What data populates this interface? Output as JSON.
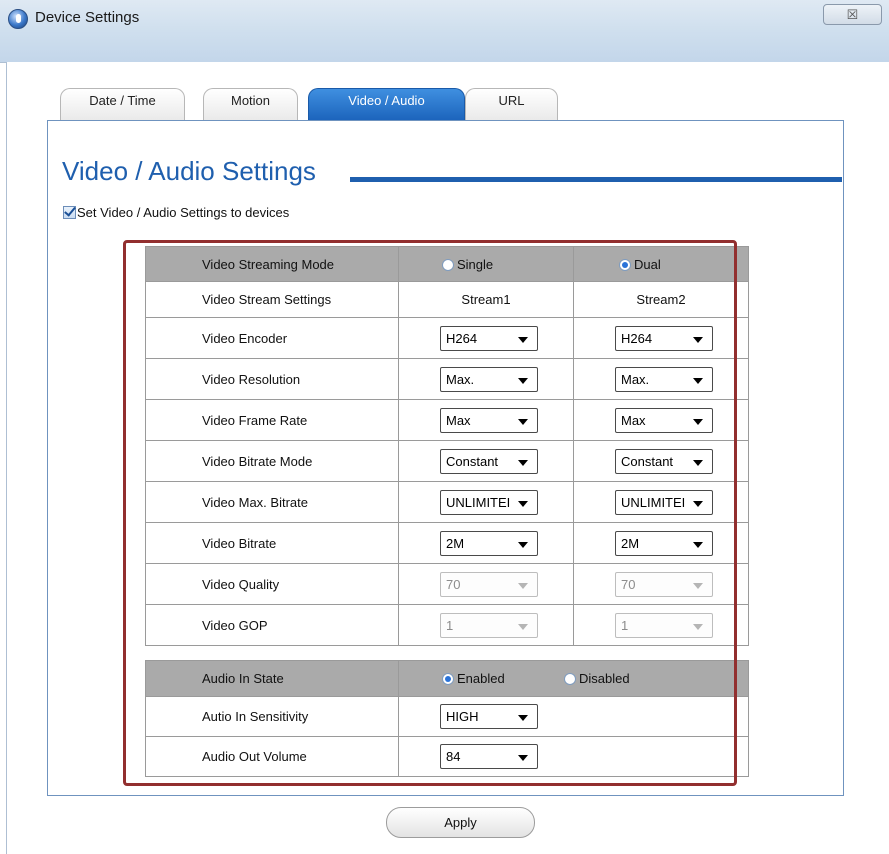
{
  "window": {
    "title": "Device Settings",
    "close_glyph": "☒"
  },
  "tabs": [
    {
      "label": "Date / Time",
      "active": false
    },
    {
      "label": "Motion",
      "active": false
    },
    {
      "label": "Video / Audio",
      "active": true
    },
    {
      "label": "URL",
      "active": false
    }
  ],
  "section": {
    "heading": "Video / Audio Settings",
    "apply_checkbox_label": "Set Video / Audio Settings to devices",
    "apply_checkbox_checked": true
  },
  "video": {
    "streaming_mode": {
      "label": "Video Streaming Mode",
      "option_single": "Single",
      "option_dual": "Dual",
      "selected": "Dual"
    },
    "stream_settings": {
      "label": "Video Stream Settings",
      "stream1": "Stream1",
      "stream2": "Stream2"
    },
    "encoder": {
      "label": "Video Encoder",
      "stream1": "H264",
      "stream2": "H264"
    },
    "resolution": {
      "label": "Video Resolution",
      "stream1": "Max.",
      "stream2": "Max."
    },
    "frame_rate": {
      "label": "Video Frame Rate",
      "stream1": "Max",
      "stream2": "Max"
    },
    "bitrate_mode": {
      "label": "Video Bitrate Mode",
      "stream1": "Constant",
      "stream2": "Constant"
    },
    "max_bitrate": {
      "label": "Video Max. Bitrate",
      "stream1": "UNLIMITEI",
      "stream2": "UNLIMITEI"
    },
    "bitrate": {
      "label": "Video Bitrate",
      "stream1": "2M",
      "stream2": "2M"
    },
    "quality": {
      "label": "Video Quality",
      "stream1": "70",
      "stream2": "70"
    },
    "gop": {
      "label": "Video GOP",
      "stream1": "1",
      "stream2": "1"
    }
  },
  "audio": {
    "in_state": {
      "label": "Audio In State",
      "option_enabled": "Enabled",
      "option_disabled": "Disabled",
      "selected": "Enabled"
    },
    "in_sensitivity": {
      "label": "Autio In Sensitivity",
      "value": "HIGH"
    },
    "out_volume": {
      "label": "Audio Out Volume",
      "value": "84"
    }
  },
  "footer": {
    "apply_label": "Apply"
  },
  "colors": {
    "accent": "#1f5fae",
    "header_row": "#aaaaaa",
    "highlight_border": "#922f2f"
  }
}
